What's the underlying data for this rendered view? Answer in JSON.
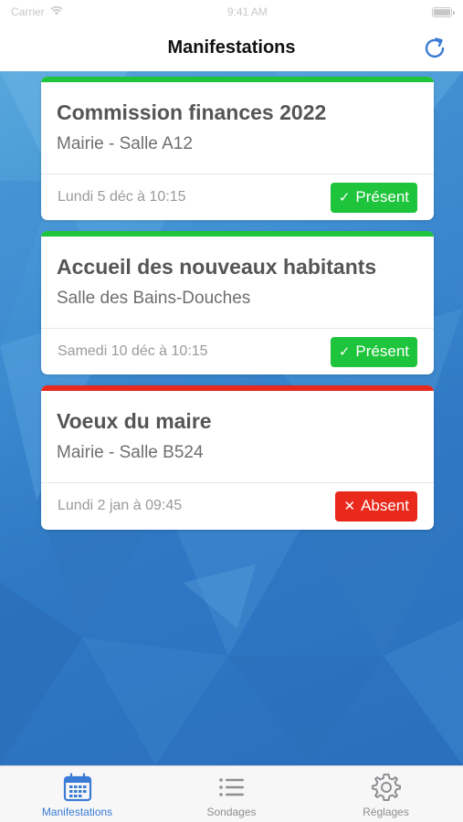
{
  "status_bar": {
    "carrier": "Carrier",
    "time": "9:41 AM"
  },
  "nav": {
    "title": "Manifestations",
    "refresh_icon": "refresh-icon"
  },
  "events": [
    {
      "title": "Commission finances 2022",
      "location": "Mairie - Salle A12",
      "date": "Lundi 5 déc à 10:15",
      "status_label": "Présent",
      "status_mark": "✓",
      "status_color": "#1ec43b",
      "bar_color": "#1ec43b"
    },
    {
      "title": "Accueil des nouveaux habitants",
      "location": "Salle des Bains-Douches",
      "date": "Samedi 10 déc à 10:15",
      "status_label": "Présent",
      "status_mark": "✓",
      "status_color": "#1ec43b",
      "bar_color": "#1ec43b"
    },
    {
      "title": "Voeux du maire",
      "location": "Mairie - Salle B524",
      "date": "Lundi 2 jan à 09:45",
      "status_label": "Absent",
      "status_mark": "✕",
      "status_color": "#e8291c",
      "bar_color": "#e8291c"
    }
  ],
  "tabs": [
    {
      "label": "Manifestations",
      "icon": "calendar-icon",
      "active": true
    },
    {
      "label": "Sondages",
      "icon": "list-icon",
      "active": false
    },
    {
      "label": "Réglages",
      "icon": "gear-icon",
      "active": false
    }
  ],
  "colors": {
    "accent": "#3a7bd5",
    "inactive_tab": "#8e8e93",
    "present": "#1ec43b",
    "absent": "#e8291c"
  }
}
